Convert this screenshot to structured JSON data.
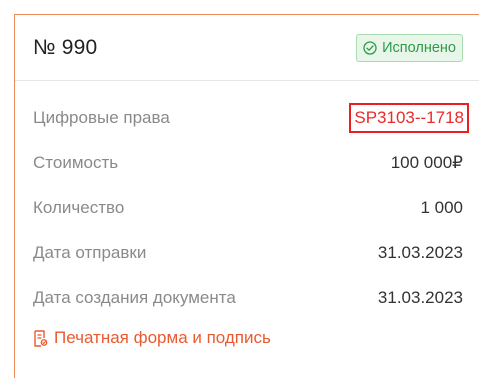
{
  "order": {
    "number": "№ 990",
    "status": "Исполнено"
  },
  "details": [
    {
      "label": "Цифровые права",
      "value": "SP3103--1718"
    },
    {
      "label": "Стоимость",
      "value": "100 000₽"
    },
    {
      "label": "Количество",
      "value": "1 000"
    },
    {
      "label": "Дата отправки",
      "value": "31.03.2023"
    },
    {
      "label": "Дата создания документа",
      "value": "31.03.2023"
    }
  ],
  "actions": {
    "print_label": "Печатная форма и подпись",
    "print_icon": "document-signature-icon"
  },
  "colors": {
    "accent": "#ea5a30",
    "status_green": "#2e9a48",
    "highlight_red": "#ea1f1f"
  }
}
